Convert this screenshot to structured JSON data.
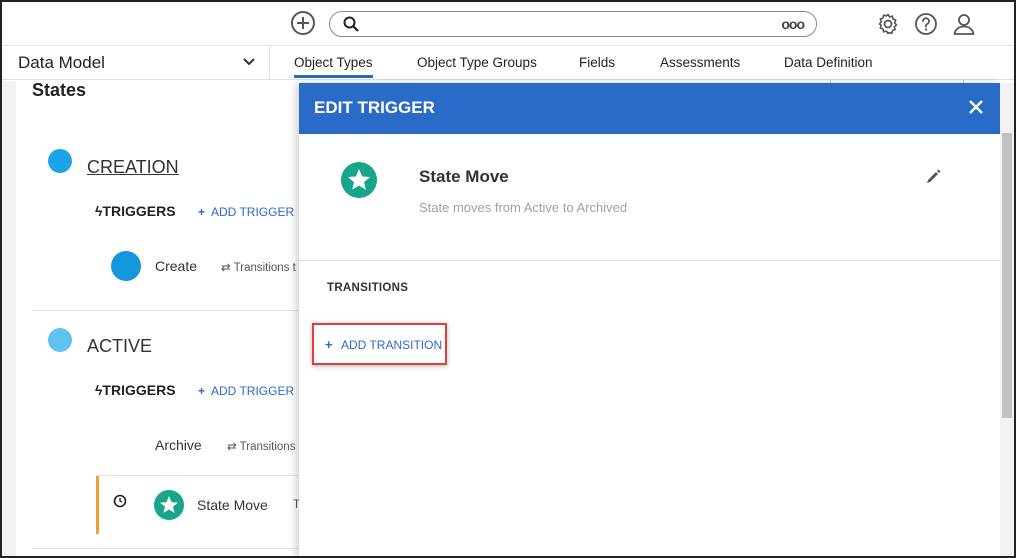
{
  "topbar": {
    "search": {
      "placeholder": "",
      "more_label": "ooo"
    },
    "icons": [
      "add-circle-icon",
      "search-icon",
      "gear-icon",
      "help-icon",
      "user-icon"
    ]
  },
  "nav": {
    "data_model": "Data Model",
    "tabs": [
      {
        "label": "Object Types",
        "active": true
      },
      {
        "label": "Object Type Groups",
        "active": false
      },
      {
        "label": "Fields",
        "active": false
      },
      {
        "label": "Assessments",
        "active": false
      },
      {
        "label": "Data Definition",
        "active": false
      }
    ]
  },
  "left": {
    "title": "States",
    "states": [
      {
        "name": "CREATION",
        "color": "#1ba4ea",
        "triggers_label": "TRIGGERS",
        "add_trigger": "ADD TRIGGER",
        "triggers": [
          {
            "name": "Create",
            "transitions": "Transitions t",
            "color": "#1597dd"
          }
        ]
      },
      {
        "name": "ACTIVE",
        "color": "#5ec3f2",
        "triggers_label": "TRIGGERS",
        "add_trigger": "ADD TRIGGER",
        "triggers": [
          {
            "name": "Archive",
            "transitions": "Transitions"
          },
          {
            "name": "State Move",
            "transitions": "T"
          }
        ]
      }
    ]
  },
  "panel": {
    "title": "EDIT TRIGGER",
    "trigger_name": "State Move",
    "trigger_description": "State moves from Active to Archived",
    "transitions_heading": "TRANSITIONS",
    "add_transition": "ADD TRANSITION",
    "accent": "#2a6bc7",
    "highlight": "#e23d3d"
  }
}
